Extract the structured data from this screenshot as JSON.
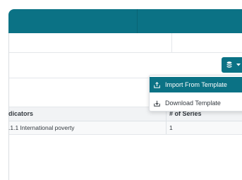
{
  "colors": {
    "header": "#0b7285",
    "accent": "#0b7285",
    "row_bg": "#f8f9fa",
    "head_bg": "#f1f3f5"
  },
  "toolbar": {
    "database_icon": "database-icon",
    "caret_icon": "caret-down-icon"
  },
  "menu": {
    "items": [
      {
        "label": "Import From Template",
        "icon": "upload-tray-icon",
        "active": true
      },
      {
        "label": "Download Template",
        "icon": "download-tray-icon",
        "active": false
      }
    ]
  },
  "table": {
    "columns": [
      "dicators",
      "# of Series"
    ],
    "rows": [
      {
        "indicator": ".1.1  International poverty",
        "series": "1"
      }
    ]
  }
}
